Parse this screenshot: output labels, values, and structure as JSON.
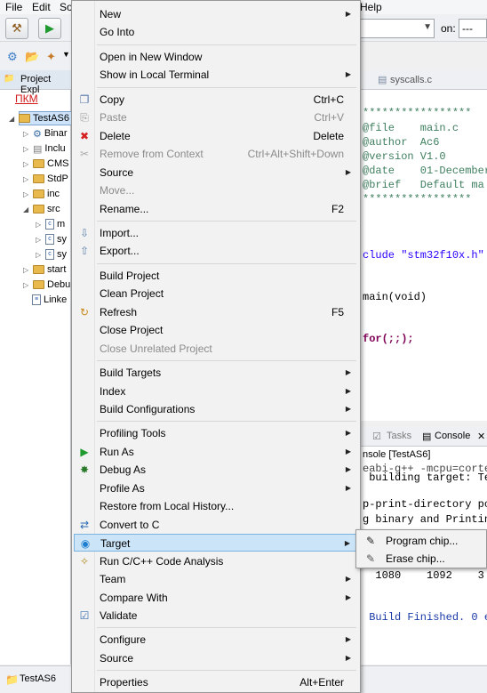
{
  "menubar": [
    "File",
    "Edit",
    "So",
    "Help"
  ],
  "toolbar": {
    "combo_label": "on:",
    "combo_value": "---"
  },
  "project_explorer": {
    "title": "Project Expl",
    "annotation": "ПКМ",
    "selected_project": "TestAS6",
    "items": [
      "Binar",
      "Inclu",
      "CMS",
      "StdP",
      "inc",
      "src",
      "m",
      "sy",
      "sy",
      "start",
      "Debu",
      "Linke"
    ]
  },
  "editor": {
    "tab_label": "syscalls.c",
    "lines": [
      "*****************",
      "@file    main.c",
      "@author  Ac6",
      "@version V1.0",
      "@date    01-December",
      "@brief   Default ma",
      "*****************",
      "clude \"stm32f10x.h\"",
      "main(void)",
      "for(;;);"
    ]
  },
  "console": {
    "tabs": [
      "Tasks",
      "Console"
    ],
    "title": "nsole [TestAS6]",
    "lines": [
      "eabi-g++ -mcpu=corte",
      " building target: Te",
      "",
      "p-print-directory po",
      "g binary and Printin",
      "",
      "  1080    1092    3",
      "",
      " Build Finished. 0 e"
    ]
  },
  "status_bar": {
    "label": "TestAS6"
  },
  "context_menu": {
    "items": [
      {
        "label": "New",
        "submenu": true
      },
      {
        "label": "Go Into"
      },
      {
        "sep": true
      },
      {
        "label": "Open in New Window"
      },
      {
        "label": "Show in Local Terminal",
        "submenu": true
      },
      {
        "sep": true
      },
      {
        "label": "Copy",
        "shortcut": "Ctrl+C",
        "icon": "copy-icon"
      },
      {
        "label": "Paste",
        "shortcut": "Ctrl+V",
        "disabled": true,
        "icon": "paste-icon"
      },
      {
        "label": "Delete",
        "shortcut": "Delete",
        "icon": "delete-icon"
      },
      {
        "label": "Remove from Context",
        "shortcut": "Ctrl+Alt+Shift+Down",
        "disabled": true,
        "icon": "remove-context-icon"
      },
      {
        "label": "Source",
        "submenu": true
      },
      {
        "label": "Move...",
        "disabled": true
      },
      {
        "label": "Rename...",
        "shortcut": "F2"
      },
      {
        "sep": true
      },
      {
        "label": "Import...",
        "icon": "import-icon"
      },
      {
        "label": "Export...",
        "icon": "export-icon"
      },
      {
        "sep": true
      },
      {
        "label": "Build Project"
      },
      {
        "label": "Clean Project"
      },
      {
        "label": "Refresh",
        "shortcut": "F5",
        "icon": "refresh-icon"
      },
      {
        "label": "Close Project"
      },
      {
        "label": "Close Unrelated Project",
        "disabled": true
      },
      {
        "sep": true
      },
      {
        "label": "Build Targets",
        "submenu": true
      },
      {
        "label": "Index",
        "submenu": true
      },
      {
        "label": "Build Configurations",
        "submenu": true
      },
      {
        "sep": true
      },
      {
        "label": "Profiling Tools",
        "submenu": true
      },
      {
        "label": "Run As",
        "submenu": true,
        "icon": "run-icon"
      },
      {
        "label": "Debug As",
        "submenu": true,
        "icon": "debug-icon"
      },
      {
        "label": "Profile As",
        "submenu": true
      },
      {
        "label": "Restore from Local History..."
      },
      {
        "label": "Convert to C",
        "icon": "convert-icon"
      },
      {
        "label": "Target",
        "submenu": true,
        "highlighted": true,
        "icon": "target-icon"
      },
      {
        "label": "Run C/C++ Code Analysis",
        "icon": "code-analysis-icon"
      },
      {
        "label": "Team",
        "submenu": true
      },
      {
        "label": "Compare With",
        "submenu": true
      },
      {
        "label": "Validate",
        "icon": "checkmark-icon"
      },
      {
        "sep": true
      },
      {
        "label": "Configure",
        "submenu": true
      },
      {
        "label": "Source",
        "submenu": true
      },
      {
        "sep": true
      },
      {
        "label": "Properties",
        "shortcut": "Alt+Enter"
      }
    ]
  },
  "target_submenu": {
    "items": [
      {
        "label": "Program chip...",
        "icon": "program-chip-icon"
      },
      {
        "label": "Erase chip...",
        "icon": "erase-chip-icon"
      }
    ]
  },
  "colors": {
    "highlight": "#cce4f7",
    "highlight_border": "#7ab3e0",
    "annotation_red": "#d21a1a",
    "comment_green": "#3f7f5f",
    "keyword_purple": "#7f0055",
    "string_blue": "#2a00ff"
  }
}
